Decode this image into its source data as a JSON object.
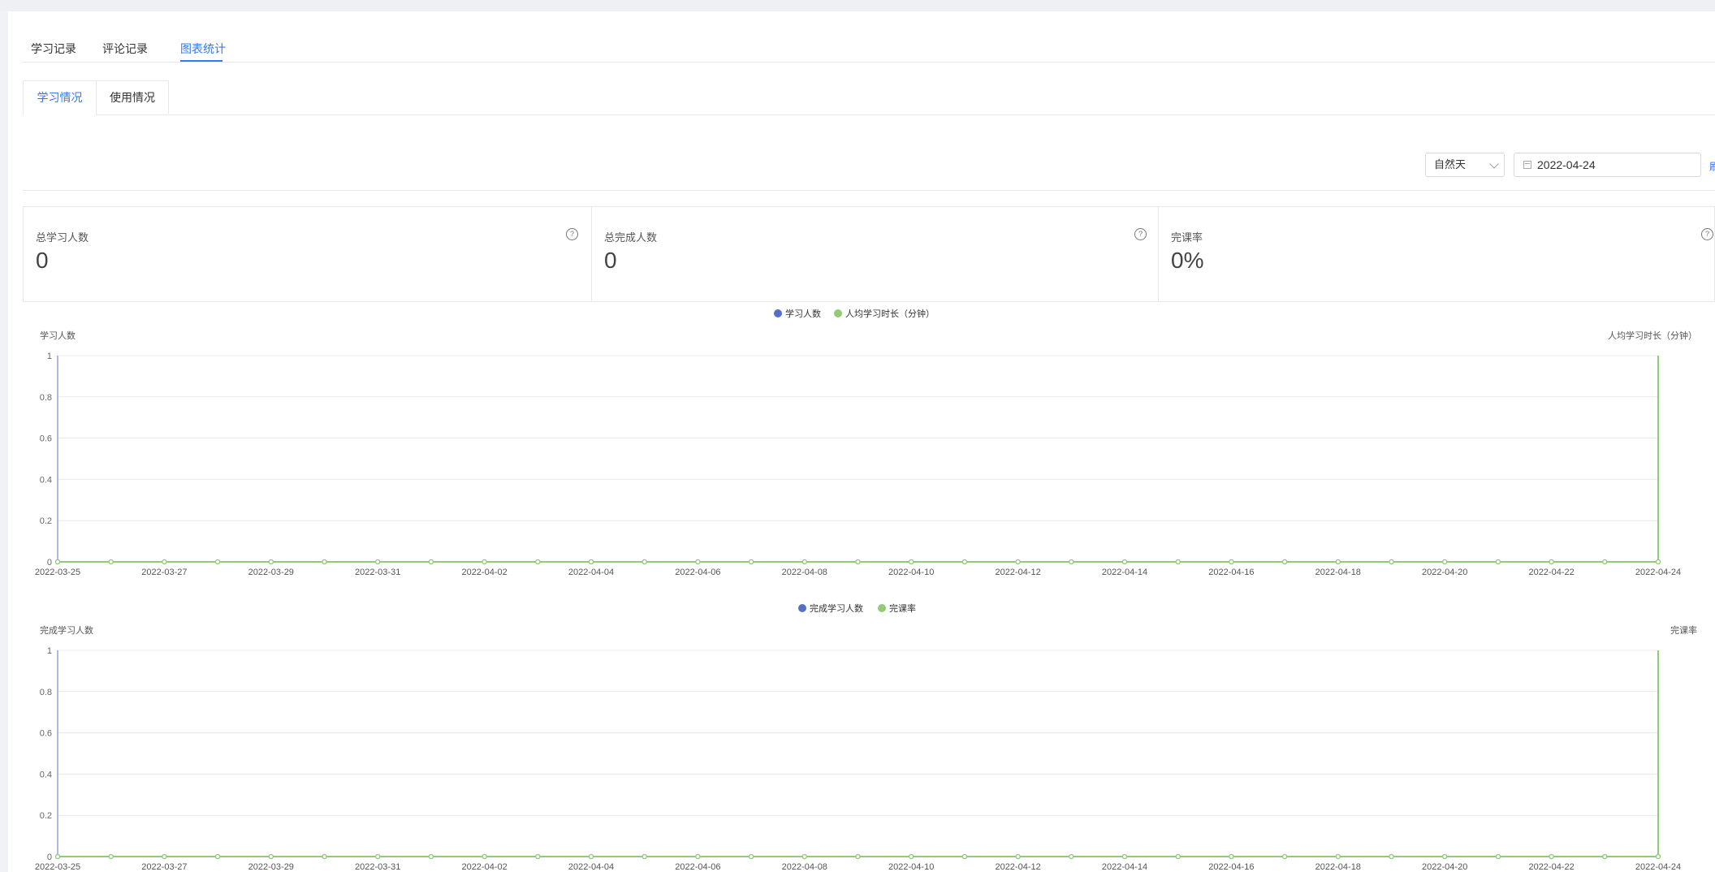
{
  "top_tabs": [
    {
      "label": "学习记录",
      "active": false
    },
    {
      "label": "评论记录",
      "active": false
    },
    {
      "label": "图表统计",
      "active": true
    }
  ],
  "sub_tabs": [
    {
      "label": "学习情况",
      "active": true
    },
    {
      "label": "使用情况",
      "active": false
    }
  ],
  "filters": {
    "period_select": "自然天",
    "date_value": "2022-04-24",
    "refresh_label": "刷新"
  },
  "stats": [
    {
      "label": "总学习人数",
      "value": "0"
    },
    {
      "label": "总完成人数",
      "value": "0"
    },
    {
      "label": "完课率",
      "value": "0%"
    }
  ],
  "icons": {
    "help": "?",
    "calendar": "calendar-icon",
    "chevron": "chevron-down-icon"
  },
  "colors": {
    "accent": "#3478f6",
    "series_blue": "#5470c6",
    "series_green": "#91cc75"
  },
  "chart_data": [
    {
      "type": "line",
      "ylabel_left": "学习人数",
      "ylabel_right": "人均学习时长（分钟）",
      "ylim": [
        0,
        1
      ],
      "yticks": [
        "0",
        "0.2",
        "0.4",
        "0.6",
        "0.8",
        "1"
      ],
      "x": [
        "2022-03-25",
        "2022-03-26",
        "2022-03-27",
        "2022-03-28",
        "2022-03-29",
        "2022-03-30",
        "2022-03-31",
        "2022-04-01",
        "2022-04-02",
        "2022-04-03",
        "2022-04-04",
        "2022-04-05",
        "2022-04-06",
        "2022-04-07",
        "2022-04-08",
        "2022-04-09",
        "2022-04-10",
        "2022-04-11",
        "2022-04-12",
        "2022-04-13",
        "2022-04-14",
        "2022-04-15",
        "2022-04-16",
        "2022-04-17",
        "2022-04-18",
        "2022-04-19",
        "2022-04-20",
        "2022-04-21",
        "2022-04-22",
        "2022-04-23",
        "2022-04-24"
      ],
      "x_tick_labels": [
        "2022-03-25",
        "2022-03-27",
        "2022-03-29",
        "2022-03-31",
        "2022-04-02",
        "2022-04-04",
        "2022-04-06",
        "2022-04-08",
        "2022-04-10",
        "2022-04-12",
        "2022-04-14",
        "2022-04-16",
        "2022-04-18",
        "2022-04-20",
        "2022-04-22",
        "2022-04-24"
      ],
      "legend_position": "top-center",
      "series": [
        {
          "name": "学习人数",
          "color": "#5470c6",
          "values": [
            0,
            0,
            0,
            0,
            0,
            0,
            0,
            0,
            0,
            0,
            0,
            0,
            0,
            0,
            0,
            0,
            0,
            0,
            0,
            0,
            0,
            0,
            0,
            0,
            0,
            0,
            0,
            0,
            0,
            0,
            0
          ]
        },
        {
          "name": "人均学习时长（分钟）",
          "color": "#91cc75",
          "values": [
            0,
            0,
            0,
            0,
            0,
            0,
            0,
            0,
            0,
            0,
            0,
            0,
            0,
            0,
            0,
            0,
            0,
            0,
            0,
            0,
            0,
            0,
            0,
            0,
            0,
            0,
            0,
            0,
            0,
            0,
            0
          ]
        }
      ]
    },
    {
      "type": "line",
      "ylabel_left": "完成学习人数",
      "ylabel_right": "完课率",
      "ylim": [
        0,
        1
      ],
      "yticks": [
        "0",
        "0.2",
        "0.4",
        "0.6",
        "0.8",
        "1"
      ],
      "x": [
        "2022-03-25",
        "2022-03-26",
        "2022-03-27",
        "2022-03-28",
        "2022-03-29",
        "2022-03-30",
        "2022-03-31",
        "2022-04-01",
        "2022-04-02",
        "2022-04-03",
        "2022-04-04",
        "2022-04-05",
        "2022-04-06",
        "2022-04-07",
        "2022-04-08",
        "2022-04-09",
        "2022-04-10",
        "2022-04-11",
        "2022-04-12",
        "2022-04-13",
        "2022-04-14",
        "2022-04-15",
        "2022-04-16",
        "2022-04-17",
        "2022-04-18",
        "2022-04-19",
        "2022-04-20",
        "2022-04-21",
        "2022-04-22",
        "2022-04-23",
        "2022-04-24"
      ],
      "x_tick_labels": [
        "2022-03-25",
        "2022-03-27",
        "2022-03-29",
        "2022-03-31",
        "2022-04-02",
        "2022-04-04",
        "2022-04-06",
        "2022-04-08",
        "2022-04-10",
        "2022-04-12",
        "2022-04-14",
        "2022-04-16",
        "2022-04-18",
        "2022-04-20",
        "2022-04-22",
        "2022-04-24"
      ],
      "legend_position": "top-center",
      "series": [
        {
          "name": "完成学习人数",
          "color": "#5470c6",
          "values": [
            0,
            0,
            0,
            0,
            0,
            0,
            0,
            0,
            0,
            0,
            0,
            0,
            0,
            0,
            0,
            0,
            0,
            0,
            0,
            0,
            0,
            0,
            0,
            0,
            0,
            0,
            0,
            0,
            0,
            0,
            0
          ]
        },
        {
          "name": "完课率",
          "color": "#91cc75",
          "values": [
            0,
            0,
            0,
            0,
            0,
            0,
            0,
            0,
            0,
            0,
            0,
            0,
            0,
            0,
            0,
            0,
            0,
            0,
            0,
            0,
            0,
            0,
            0,
            0,
            0,
            0,
            0,
            0,
            0,
            0,
            0
          ]
        }
      ]
    }
  ]
}
